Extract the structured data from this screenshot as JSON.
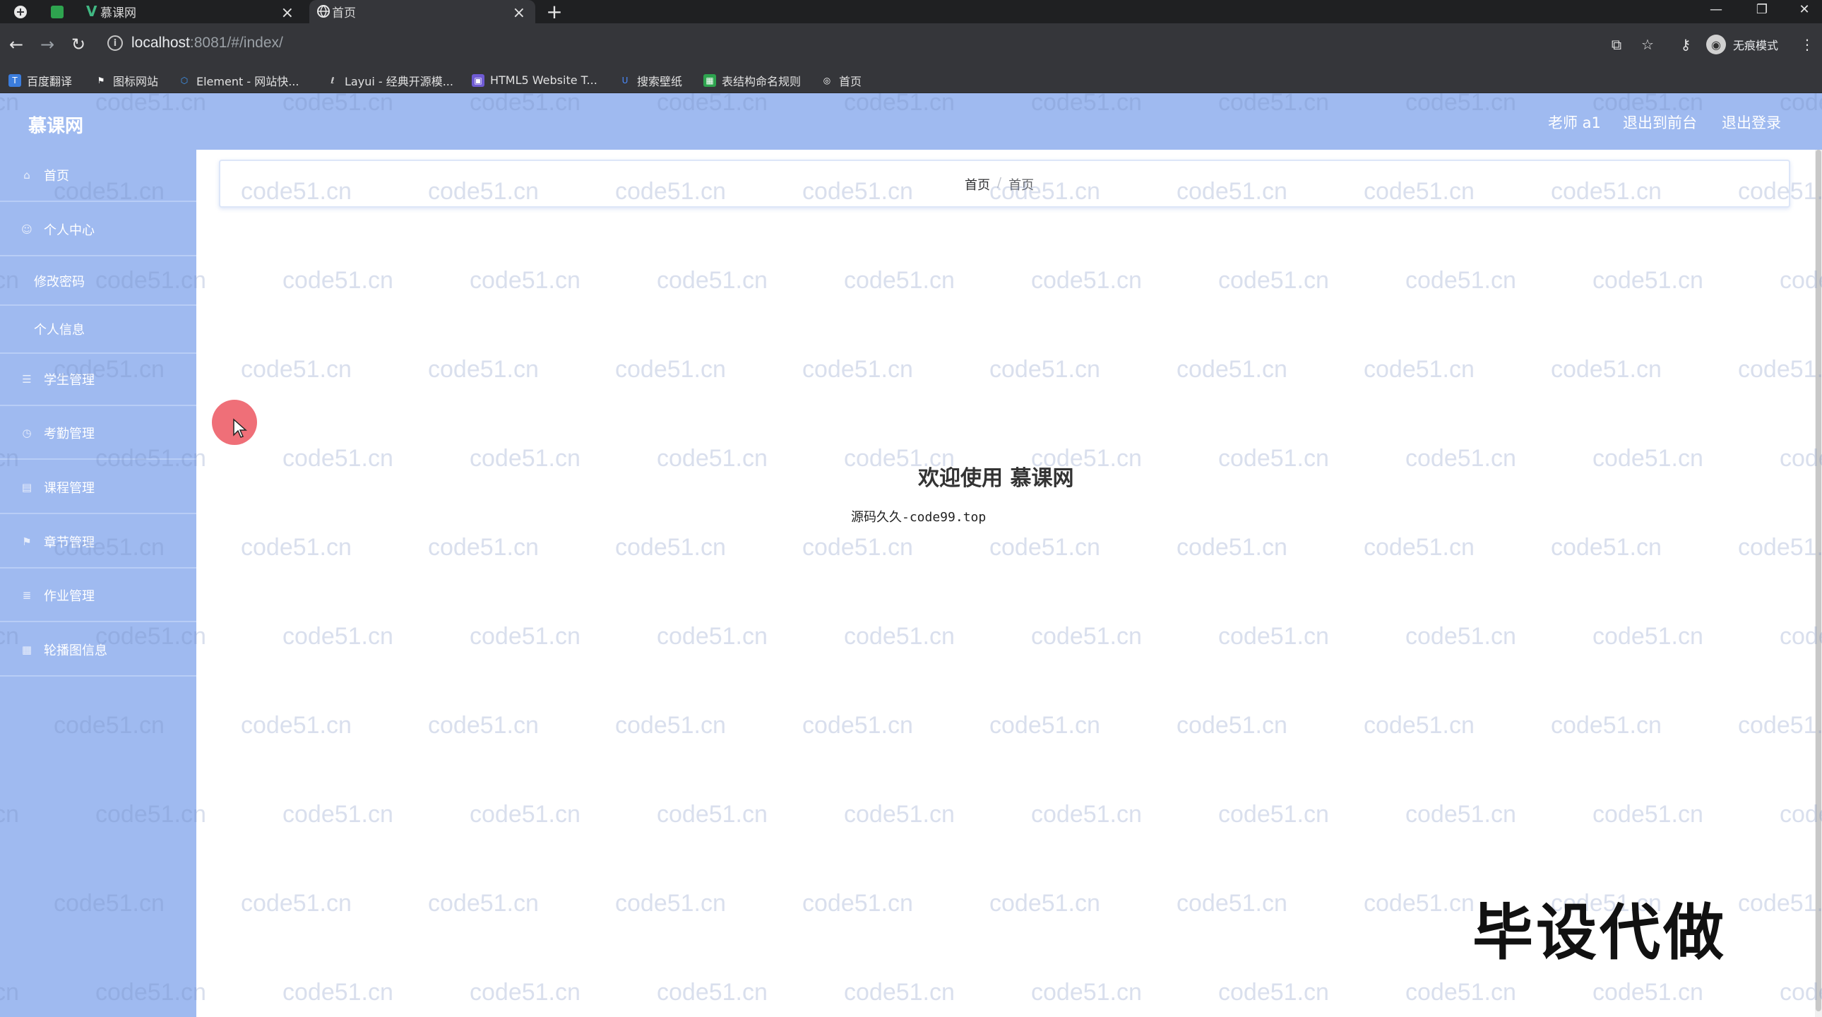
{
  "browser": {
    "tabs": [
      {
        "title": "慕课网",
        "active": false
      },
      {
        "title": "首页",
        "active": true
      }
    ],
    "url": {
      "host": "localhost",
      "rest": ":8081/#/index/"
    },
    "profile_label": "无痕模式",
    "bookmarks": [
      "百度翻译",
      "图标网站",
      "Element - 网站快...",
      "Layui - 经典开源模...",
      "HTML5 Website T...",
      "搜索壁纸",
      "表结构命名规则",
      "首页"
    ]
  },
  "app": {
    "title": "慕课网",
    "header_links": [
      "老师 a1",
      "退出到前台",
      "退出登录"
    ],
    "menu": {
      "home": "首页",
      "personal": "个人中心",
      "change_password": "修改密码",
      "personal_info": "个人信息",
      "student_mgmt": "学生管理",
      "attendance_mgmt": "考勤管理",
      "course_mgmt": "课程管理",
      "chapter_mgmt": "章节管理",
      "homework_mgmt": "作业管理",
      "carousel_info": "轮播图信息"
    },
    "breadcrumb": [
      "首页",
      "首页"
    ],
    "welcome": "欢迎使用 慕课网",
    "source_note": "源码久久-code99.top"
  },
  "watermark": "code51.cn",
  "overlay_caption": "毕设代做",
  "colors": {
    "sidebar": "#9fbaf0",
    "header": "#9fbaf0",
    "cursor": "#ec5660"
  }
}
